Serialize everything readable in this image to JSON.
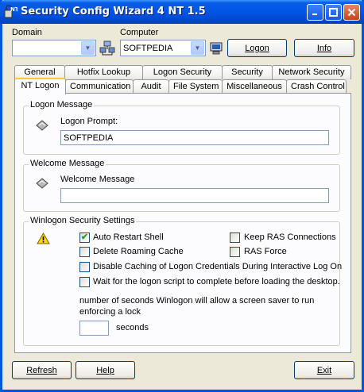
{
  "window": {
    "title": "Security Config Wizard 4 NT  1.5"
  },
  "top": {
    "domain_label": "Domain",
    "domain_value": "",
    "computer_label": "Computer",
    "computer_value": "SOFTPEDIA",
    "logon_button": "Logon",
    "info_button": "Info"
  },
  "tabs": {
    "row1": [
      "General",
      "Hotfix Lookup",
      "Logon Security",
      "Security",
      "Network Security"
    ],
    "row2": [
      "NT Logon",
      "Communication",
      "Audit",
      "File System",
      "Miscellaneous",
      "Crash Control"
    ],
    "active": "NT Logon"
  },
  "logon_message": {
    "group_title": "Logon Message",
    "prompt_label": "Logon Prompt:",
    "prompt_value": "SOFTPEDIA"
  },
  "welcome_message": {
    "group_title": "Welcome Message",
    "message_label": "Welcome Message",
    "message_value": ""
  },
  "winlogon": {
    "group_title": "Winlogon Security Settings",
    "options": [
      {
        "label": "Auto Restart Shell",
        "checked": true
      },
      {
        "label": "Keep RAS Connections",
        "checked": false
      },
      {
        "label": "Delete Roaming Cache",
        "checked": false
      },
      {
        "label": "RAS Force",
        "checked": false
      },
      {
        "label": "Disable Caching of Logon Credentials During Interactive Log On",
        "checked": false
      },
      {
        "label": "Wait for the logon script to complete before loading the desktop.",
        "checked": false
      }
    ],
    "screensaver_text_line1": "number of seconds Winlogon will allow a screen saver to run",
    "screensaver_text_line2": "enforcing a lock",
    "seconds_value": "",
    "seconds_label": "seconds"
  },
  "bottom": {
    "refresh_button": "Refresh",
    "help_button": "Help",
    "exit_button": "Exit"
  }
}
